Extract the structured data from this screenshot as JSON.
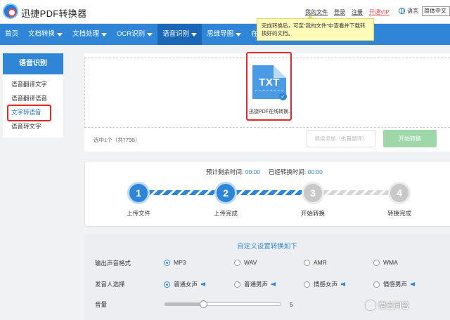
{
  "header": {
    "brand": "迅捷PDF转换器",
    "links": [
      "我的文件",
      "登录",
      "注册"
    ],
    "vip": "开通VIP",
    "lang_label": "语言",
    "lang_value": "简体中文"
  },
  "nav": [
    {
      "label": "首页",
      "dropdown": false,
      "active": false
    },
    {
      "label": "文档转换",
      "dropdown": true,
      "active": false
    },
    {
      "label": "文档处理",
      "dropdown": true,
      "active": false
    },
    {
      "label": "OCR识别",
      "dropdown": true,
      "active": false
    },
    {
      "label": "语音识别",
      "dropdown": true,
      "active": true
    },
    {
      "label": "思维导图",
      "dropdown": true,
      "active": false
    },
    {
      "label": "在线",
      "dropdown": false,
      "active": false
    }
  ],
  "tooltip": "完成转换后，可至“我的文件”中查看并下载转换好的文档。",
  "sidebar": {
    "title": "语音识别",
    "items": [
      "语音翻译文字",
      "语音翻译语音",
      "文字转语音",
      "语音转文字"
    ],
    "current": 2
  },
  "upload": {
    "file_type": "TXT",
    "file_name": "迅捷PDF在线转换...",
    "selected_info": "选中1个（共779B）",
    "add_button": "继续添加（批量翻译）",
    "start_button": "开始转换"
  },
  "progress": {
    "remaining_label": "预计剩余时间:",
    "remaining_value": "00:00",
    "elapsed_label": "已经转换时间:",
    "elapsed_value": "00:00",
    "steps": [
      {
        "num": "1",
        "label": "上传文件",
        "done": true
      },
      {
        "num": "2",
        "label": "上传完成",
        "done": true
      },
      {
        "num": "3",
        "label": "开始转换",
        "done": false
      },
      {
        "num": "4",
        "label": "转换完成",
        "done": false
      }
    ]
  },
  "settings": {
    "title": "自定义设置转换如下",
    "format_label": "输出声音格式",
    "formats": [
      "MP3",
      "WAV",
      "AMR",
      "WMA"
    ],
    "format_selected": 0,
    "voice_label": "发音人选择",
    "voices": [
      "普通女声",
      "普通男声",
      "情感女声",
      "情感男声"
    ],
    "voice_selected": 0,
    "volume_label": "音量",
    "volume_value": "5",
    "volume_fraction": 0.33
  },
  "watermark": "悟空问答",
  "colors": {
    "primary": "#2f86d6",
    "primary_dark": "#1a67b8",
    "highlight": "#e52727",
    "start_button": "#9ed8a9",
    "tooltip_bg": "#fffbb8"
  }
}
